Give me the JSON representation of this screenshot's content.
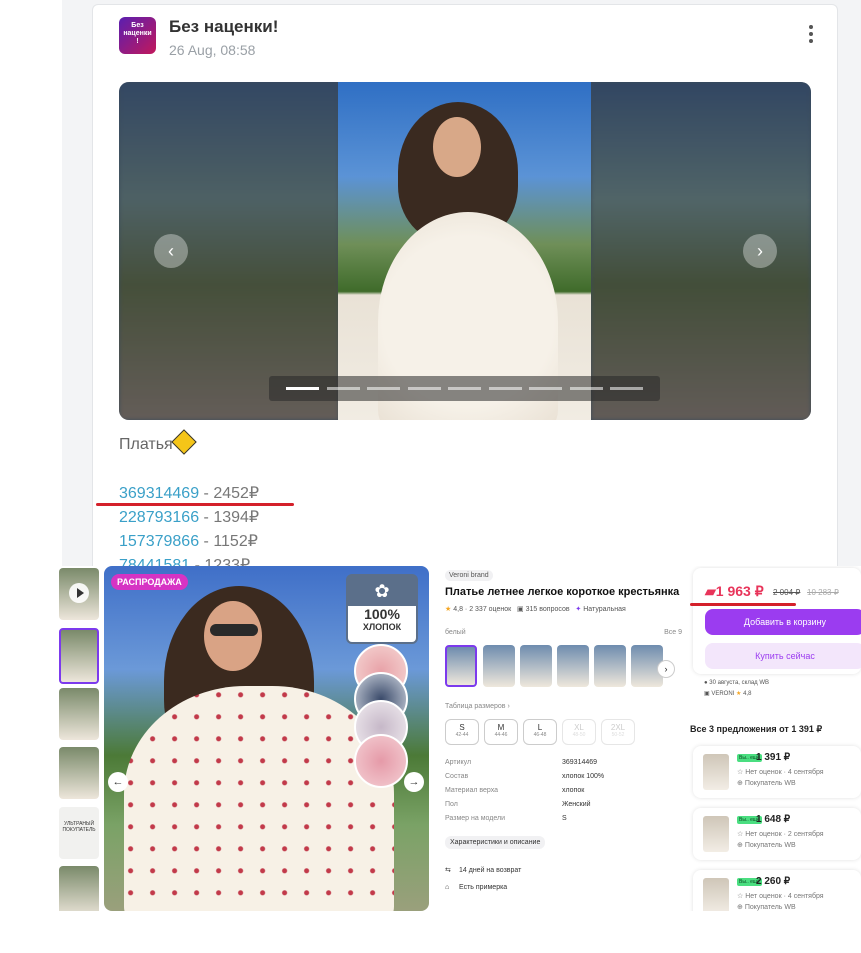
{
  "post": {
    "channel": "Без наценки!",
    "avatar_lines": [
      "Без",
      "наценки",
      "!"
    ],
    "date": "26 Aug, 08:58",
    "text": "Платья",
    "items": [
      {
        "code": "369314469",
        "price": " - 2452₽"
      },
      {
        "code": "228793166",
        "price": " - 1394₽"
      },
      {
        "code": "157379866",
        "price": " - 1152₽"
      },
      {
        "code": "78441581",
        "price": " - 1233₽"
      }
    ],
    "gallery": {
      "prev": "‹",
      "next": "›",
      "dot_count": 9,
      "active_dot": 0
    }
  },
  "product": {
    "sale_badge": "РАСПРОДАЖА",
    "cotton_pct": "100%",
    "cotton_label": "ХЛОПОК",
    "thumb_text": "УЛЬТРАНЫЙ ПОКУПАТЕЛЬ",
    "brand": "Veroni brand",
    "title": "Платье летнее легкое короткое крестьянка",
    "rating": "4,8",
    "reviews": "2 337 оценок",
    "questions": "315 вопросов",
    "natural": "Натуральная",
    "color_label": "белый",
    "color_all": "Все 9",
    "size_table": "Таблица размеров",
    "sizes": [
      {
        "label": "S",
        "ru": "42-44",
        "available": true
      },
      {
        "label": "M",
        "ru": "44-46",
        "available": true
      },
      {
        "label": "L",
        "ru": "46-48",
        "available": true
      },
      {
        "label": "XL",
        "ru": "48-50",
        "available": false
      },
      {
        "label": "2XL",
        "ru": "50-52",
        "available": false
      }
    ],
    "specs": [
      {
        "k": "Артикул",
        "v": "369314469"
      },
      {
        "k": "Состав",
        "v": "хлопок 100%"
      },
      {
        "k": "Материал верха",
        "v": "хлопок"
      },
      {
        "k": "Пол",
        "v": "Женский"
      },
      {
        "k": "Размер на модели",
        "v": "S"
      }
    ],
    "char_button": "Характеристики и описание",
    "return_text": "14 дней на возврат",
    "fitting_text": "Есть примерка"
  },
  "buybox": {
    "price": "1 963 ₽",
    "old_price": "2 004 ₽",
    "old_price2": "10 283 ₽",
    "add_to_cart": "Добавить в корзину",
    "buy_now": "Купить сейчас",
    "delivery": "30 августа, склад WB",
    "seller": "VERONI",
    "seller_rating": "4,8",
    "offers_title": "Все 3 предложения от 1 391 ₽",
    "offers": [
      {
        "badge": "Вы.. ещё",
        "price": "1 391 ₽",
        "reviews": "Нет оценок · 4 сентября",
        "seller": "Покупатель WB"
      },
      {
        "badge": "Вы.. ещё",
        "price": "1 648 ₽",
        "reviews": "Нет оценок · 2 сентября",
        "seller": "Покупатель WB"
      },
      {
        "badge": "Вы.. ещё",
        "price": "2 260 ₽",
        "reviews": "Нет оценок · 4 сентября",
        "seller": "Покупатель WB"
      }
    ]
  },
  "colors": {
    "accent": "#7c3aed",
    "link": "#3aa0c8",
    "highlight": "#d4202a",
    "price": "#e8345a"
  }
}
